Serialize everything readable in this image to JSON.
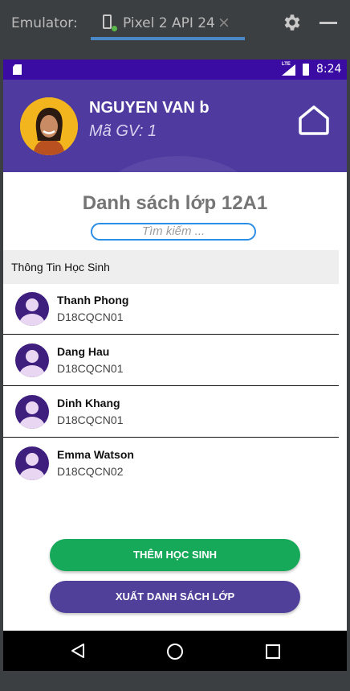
{
  "emulator": {
    "label": "Emulator:",
    "device_tab": "Pixel 2 API 24",
    "close_glyph": "×",
    "icons": [
      "phone-icon",
      "gear-icon",
      "minimize-icon"
    ]
  },
  "status_bar": {
    "time": "8:24",
    "network": "LTE",
    "color": "#3a0ca3"
  },
  "header": {
    "teacher_name": "NGUYEN VAN b",
    "teacher_id": "Mã GV: 1",
    "color": "#4f3aa0"
  },
  "main": {
    "title": "Danh sách lớp 12A1",
    "search_placeholder": "Tìm kiếm ...",
    "section_label": "Thông Tin Học Sinh",
    "students": [
      {
        "name": "Thanh Phong",
        "class": "D18CQCN01"
      },
      {
        "name": "Dang Hau",
        "class": "D18CQCN01"
      },
      {
        "name": "Dinh Khang",
        "class": "D18CQCN01"
      },
      {
        "name": "Emma Watson",
        "class": "D18CQCN02"
      }
    ]
  },
  "buttons": {
    "add_student": "THÊM HỌC SINH",
    "export_list": "XUẤT DANH SÁCH LỚP",
    "add_color": "#17a95a",
    "export_color": "#50409a"
  },
  "nav": {
    "icons": [
      "back-icon",
      "home-circle-icon",
      "recents-icon"
    ]
  }
}
